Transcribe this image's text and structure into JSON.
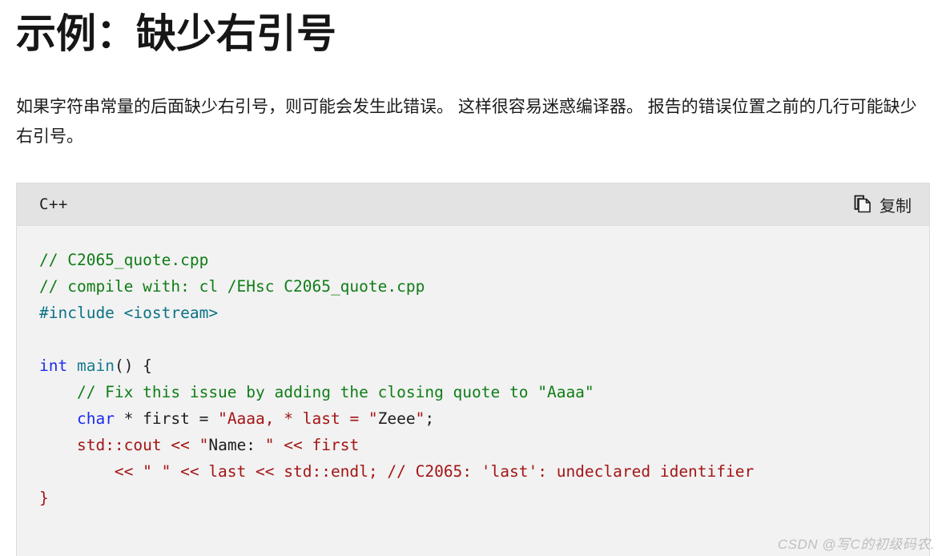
{
  "page": {
    "title": "示例：缺少右引号",
    "paragraph": "如果字符串常量的后面缺少右引号，则可能会发生此错误。 这样很容易迷惑编译器。 报告的错误位置之前的几行可能缺少右引号。"
  },
  "code_block": {
    "language_label": "C++",
    "copy_label": "复制",
    "copy_icon": "copy-icon",
    "header_bg": "#e3e3e3",
    "body_bg": "#f2f2f2",
    "border_color": "#dcdcdc",
    "lines": [
      {
        "tokens": [
          {
            "t": "// C2065_quote.cpp",
            "c": "comment"
          }
        ]
      },
      {
        "tokens": [
          {
            "t": "// compile with: cl /EHsc C2065_quote.cpp",
            "c": "comment"
          }
        ]
      },
      {
        "tokens": [
          {
            "t": "#include <iostream>",
            "c": "pre"
          }
        ]
      },
      {
        "tokens": [
          {
            "t": "",
            "c": "plain"
          }
        ]
      },
      {
        "tokens": [
          {
            "t": "int",
            "c": "kw"
          },
          {
            "t": " ",
            "c": "plain"
          },
          {
            "t": "main",
            "c": "fn"
          },
          {
            "t": "() {",
            "c": "plain"
          }
        ]
      },
      {
        "tokens": [
          {
            "t": "    // Fix this issue by adding the closing quote to \"Aaaa\"",
            "c": "comment"
          }
        ]
      },
      {
        "tokens": [
          {
            "t": "    ",
            "c": "plain"
          },
          {
            "t": "char",
            "c": "kw"
          },
          {
            "t": " * first = ",
            "c": "plain"
          },
          {
            "t": "\"Aaaa, * last = \"",
            "c": "str"
          },
          {
            "t": "Zeee",
            "c": "plain"
          },
          {
            "t": "\"",
            "c": "str"
          },
          {
            "t": ";",
            "c": "plain"
          }
        ]
      },
      {
        "tokens": [
          {
            "t": "    ",
            "c": "plain"
          },
          {
            "t": "std::cout << \"",
            "c": "red"
          },
          {
            "t": "Name: ",
            "c": "plain"
          },
          {
            "t": "\" << first",
            "c": "red"
          }
        ]
      },
      {
        "tokens": [
          {
            "t": "        ",
            "c": "plain"
          },
          {
            "t": "<< \" \" << last << std::endl; // C2065: 'last': undeclared identifier",
            "c": "red"
          }
        ]
      },
      {
        "tokens": [
          {
            "t": "}",
            "c": "red"
          }
        ]
      }
    ],
    "colors": {
      "comment": "#0f7d17",
      "preprocessor": "#0b7285",
      "keyword": "#1d2cef",
      "function": "#177b91",
      "string": "#a31515",
      "plain": "#1f1f1f"
    }
  },
  "watermark": {
    "text": "CSDN @写C的初级码农."
  }
}
